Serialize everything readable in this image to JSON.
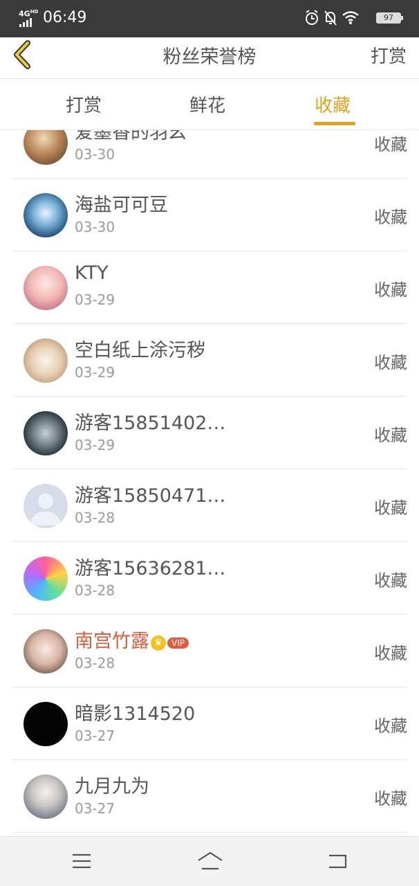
{
  "status_bar": {
    "network": "4G",
    "network_sup": "HD",
    "time": "06:49",
    "icons": [
      "alarm-icon",
      "bell-off-icon",
      "wifi-icon"
    ],
    "battery": "97"
  },
  "header": {
    "title": "粉丝荣誉榜",
    "action_label": "打赏",
    "accent_color": "#e6a11c"
  },
  "tabs": [
    {
      "label": "打赏",
      "active": false
    },
    {
      "label": "鲜花",
      "active": false
    },
    {
      "label": "收藏",
      "active": true
    }
  ],
  "list": {
    "items": [
      {
        "name": "爱墨香的羽幺",
        "date": "03-30",
        "action": "收藏",
        "avatar": "avatar-user"
      },
      {
        "name": "海盐可可豆",
        "date": "03-30",
        "action": "收藏",
        "avatar": "avatar-user"
      },
      {
        "name": "KTY",
        "date": "03-29",
        "action": "收藏",
        "avatar": "avatar-user"
      },
      {
        "name": "空白纸上涂污秽",
        "date": "03-29",
        "action": "收藏",
        "avatar": "avatar-user"
      },
      {
        "name": "游客15851402…",
        "date": "03-29",
        "action": "收藏",
        "avatar": "avatar-user"
      },
      {
        "name": "游客15850471…",
        "date": "03-28",
        "action": "收藏",
        "avatar": "default-avatar-icon"
      },
      {
        "name": "游客15636281…",
        "date": "03-28",
        "action": "收藏",
        "avatar": "avatar-user"
      },
      {
        "name": "南宫竹露",
        "date": "03-28",
        "action": "收藏",
        "avatar": "avatar-user",
        "vip": true,
        "vip_label": "VIP",
        "crown_glyph": "♛"
      },
      {
        "name": "暗影1314520",
        "date": "03-27",
        "action": "收藏",
        "avatar": "avatar-user"
      },
      {
        "name": "九月九为",
        "date": "03-27",
        "action": "收藏",
        "avatar": "avatar-user"
      }
    ]
  },
  "nav_bar": {
    "icons": [
      "menu-icon",
      "home-icon",
      "back-nav-icon"
    ]
  }
}
